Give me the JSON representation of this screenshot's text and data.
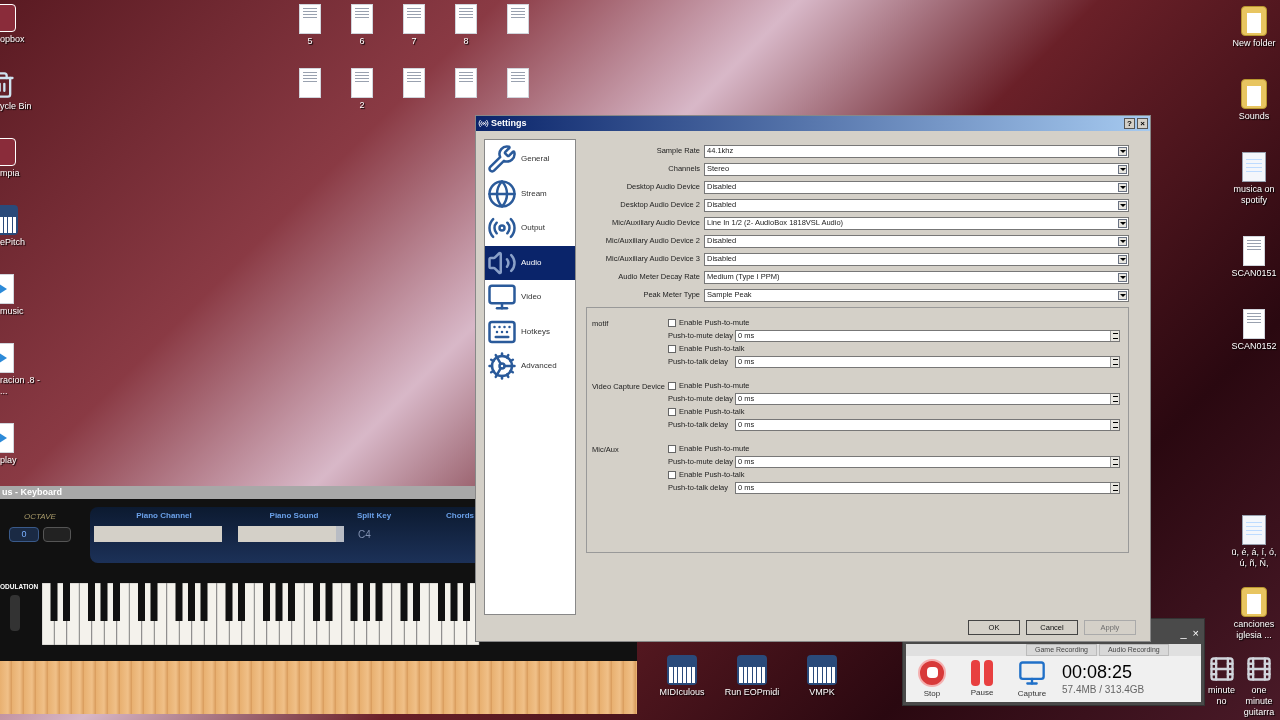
{
  "desktop": {
    "left_icons": [
      {
        "label": "opbox",
        "kind": "app"
      },
      {
        "label": "ycle Bin",
        "kind": "trash"
      },
      {
        "label": "mpia",
        "kind": "app"
      },
      {
        "label": "ePitch",
        "kind": "piano"
      },
      {
        "label": "music",
        "kind": "media"
      },
      {
        "label": "racion .8 - ...",
        "kind": "media"
      },
      {
        "label": "play",
        "kind": "media"
      }
    ],
    "document_rows": [
      [
        {
          "kind": "document",
          "label": "5"
        },
        {
          "kind": "document",
          "label": "6"
        },
        {
          "kind": "document",
          "label": "7"
        },
        {
          "kind": "document",
          "label": "8"
        },
        {
          "kind": "document"
        }
      ],
      [
        {
          "kind": "document"
        },
        {
          "kind": "document",
          "label": "2"
        },
        {
          "kind": "document"
        },
        {
          "kind": "document"
        },
        {
          "kind": "document"
        }
      ]
    ],
    "right_icons": [
      {
        "label": "New folder",
        "kind": "folder"
      },
      {
        "label": "Sounds",
        "kind": "folder"
      },
      {
        "label": "musica on spotify",
        "kind": "text"
      },
      {
        "label": "SCAN0151",
        "kind": "scan"
      },
      {
        "label": "SCAN0152",
        "kind": "scan"
      }
    ],
    "right_lower_icons": [
      {
        "label": "ü, é, á, í, ó, ú, ñ, Ñ,",
        "kind": "text"
      },
      {
        "label": "canciones iglesia ...",
        "kind": "folder"
      }
    ],
    "bottom_shortcuts": [
      {
        "label": "MIDIculous",
        "kind": "piano"
      },
      {
        "label": "Run EOPmidi",
        "kind": "piano"
      },
      {
        "label": "VMPK",
        "kind": "piano"
      }
    ],
    "corner_icons": [
      {
        "label": "minute no",
        "kind": "video"
      },
      {
        "label": "one minute guitarra",
        "kind": "video"
      }
    ]
  },
  "keyboard_window": {
    "title": "us - Keyboard",
    "octave_label": "OCTAVE",
    "octave_value": "0",
    "modulation_label": "ODULATION",
    "columns": [
      "Piano Channel",
      "Piano Sound",
      "Split Key",
      "Chords"
    ],
    "split_key": "C4"
  },
  "settings_window": {
    "title": "Settings",
    "title_buttons": [
      "?",
      "×"
    ],
    "nav": [
      {
        "label": "General",
        "selected": false
      },
      {
        "label": "Stream",
        "selected": false
      },
      {
        "label": "Output",
        "selected": false
      },
      {
        "label": "Audio",
        "selected": true
      },
      {
        "label": "Video",
        "selected": false
      },
      {
        "label": "Hotkeys",
        "selected": false
      },
      {
        "label": "Advanced",
        "selected": false
      }
    ],
    "fields": [
      {
        "label": "Sample Rate",
        "value": "44.1khz"
      },
      {
        "label": "Channels",
        "value": "Stereo"
      },
      {
        "label": "Desktop Audio Device",
        "value": "Disabled"
      },
      {
        "label": "Desktop Audio Device 2",
        "value": "Disabled"
      },
      {
        "label": "Mic/Auxiliary Audio Device",
        "value": "Line In 1/2 (2- AudioBox 1818VSL Audio)"
      },
      {
        "label": "Mic/Auxiliary Audio Device 2",
        "value": "Disabled"
      },
      {
        "label": "Mic/Auxiliary Audio Device 3",
        "value": "Disabled"
      },
      {
        "label": "Audio Meter Decay Rate",
        "value": "Medium (Type I PPM)"
      },
      {
        "label": "Peak Meter Type",
        "value": "Sample Peak"
      }
    ],
    "hotkey_groups": [
      {
        "device": "motif",
        "rows": [
          {
            "kind": "checkbox",
            "label": "Enable Push-to-mute",
            "checked": false
          },
          {
            "kind": "spin",
            "label": "Push-to-mute delay",
            "value": "0 ms"
          },
          {
            "kind": "checkbox",
            "label": "Enable Push-to-talk",
            "checked": false
          },
          {
            "kind": "spin",
            "label": "Push-to-talk delay",
            "value": "0 ms"
          }
        ]
      },
      {
        "device": "Video Capture Device",
        "rows": [
          {
            "kind": "checkbox",
            "label": "Enable Push-to-mute",
            "checked": false
          },
          {
            "kind": "spin",
            "label": "Push-to-mute delay",
            "value": "0 ms"
          },
          {
            "kind": "checkbox",
            "label": "Enable Push-to-talk",
            "checked": false
          },
          {
            "kind": "spin",
            "label": "Push-to-talk delay",
            "value": "0 ms"
          }
        ]
      },
      {
        "device": "Mic/Aux",
        "rows": [
          {
            "kind": "checkbox",
            "label": "Enable Push-to-mute",
            "checked": false
          },
          {
            "kind": "spin",
            "label": "Push-to-mute delay",
            "value": "0 ms"
          },
          {
            "kind": "checkbox",
            "label": "Enable Push-to-talk",
            "checked": false
          },
          {
            "kind": "spin",
            "label": "Push-to-talk delay",
            "value": "0 ms"
          }
        ]
      }
    ],
    "buttons": [
      {
        "label": "OK",
        "disabled": false
      },
      {
        "label": "Cancel",
        "disabled": false
      },
      {
        "label": "Apply",
        "disabled": true
      }
    ]
  },
  "recorder_window": {
    "title_buttons": [
      "_",
      "×"
    ],
    "tabs": [
      "Game Recording",
      "Audio Recording"
    ],
    "actions": [
      {
        "kind": "stop",
        "label": "Stop"
      },
      {
        "kind": "pause",
        "label": "Pause"
      },
      {
        "kind": "capture",
        "label": "Capture"
      }
    ],
    "timer": "00:08:25",
    "storage": "57.4MB / 313.4GB"
  }
}
